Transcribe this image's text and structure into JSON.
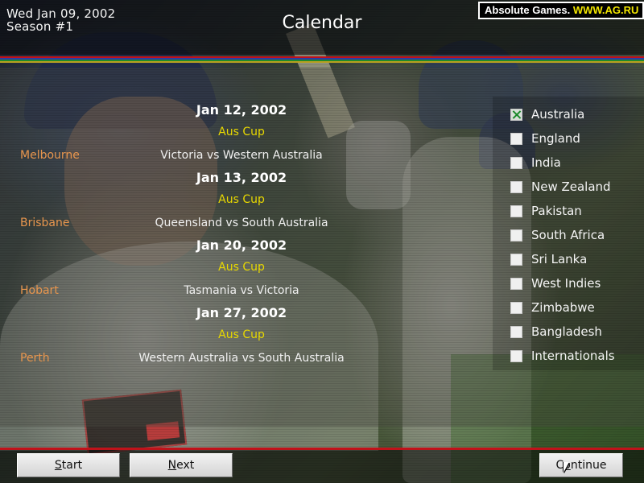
{
  "header": {
    "date": "Wed Jan 09, 2002",
    "season": "Season #1",
    "title": "Calendar"
  },
  "ad": {
    "name": "Absolute Games.",
    "url": "WWW.AG.RU"
  },
  "schedule": [
    {
      "date": "Jan 12, 2002",
      "competition": "Aus Cup",
      "venue": "Melbourne",
      "match": "Victoria vs Western Australia"
    },
    {
      "date": "Jan 13, 2002",
      "competition": "Aus Cup",
      "venue": "Brisbane",
      "match": "Queensland vs South Australia"
    },
    {
      "date": "Jan 20, 2002",
      "competition": "Aus Cup",
      "venue": "Hobart",
      "match": "Tasmania vs Victoria"
    },
    {
      "date": "Jan 27, 2002",
      "competition": "Aus Cup",
      "venue": "Perth",
      "match": "Western Australia vs South Australia"
    }
  ],
  "countries": [
    {
      "label": "Australia",
      "checked": true
    },
    {
      "label": "England",
      "checked": false
    },
    {
      "label": "India",
      "checked": false
    },
    {
      "label": "New Zealand",
      "checked": false
    },
    {
      "label": "Pakistan",
      "checked": false
    },
    {
      "label": "South Africa",
      "checked": false
    },
    {
      "label": "Sri Lanka",
      "checked": false
    },
    {
      "label": "West Indies",
      "checked": false
    },
    {
      "label": "Zimbabwe",
      "checked": false
    },
    {
      "label": "Bangladesh",
      "checked": false
    },
    {
      "label": "Internationals",
      "checked": false
    }
  ],
  "buttons": {
    "start": {
      "key": "S",
      "rest": "tart"
    },
    "next": {
      "key": "N",
      "rest": "ext"
    },
    "continue": {
      "pre": "C",
      "key": "o",
      "rest": "ntinue"
    }
  },
  "colors": {
    "venue": "#e8964e",
    "competition": "#e8d800",
    "accent_red": "#c0121a",
    "ad_url": "#f2e600"
  }
}
